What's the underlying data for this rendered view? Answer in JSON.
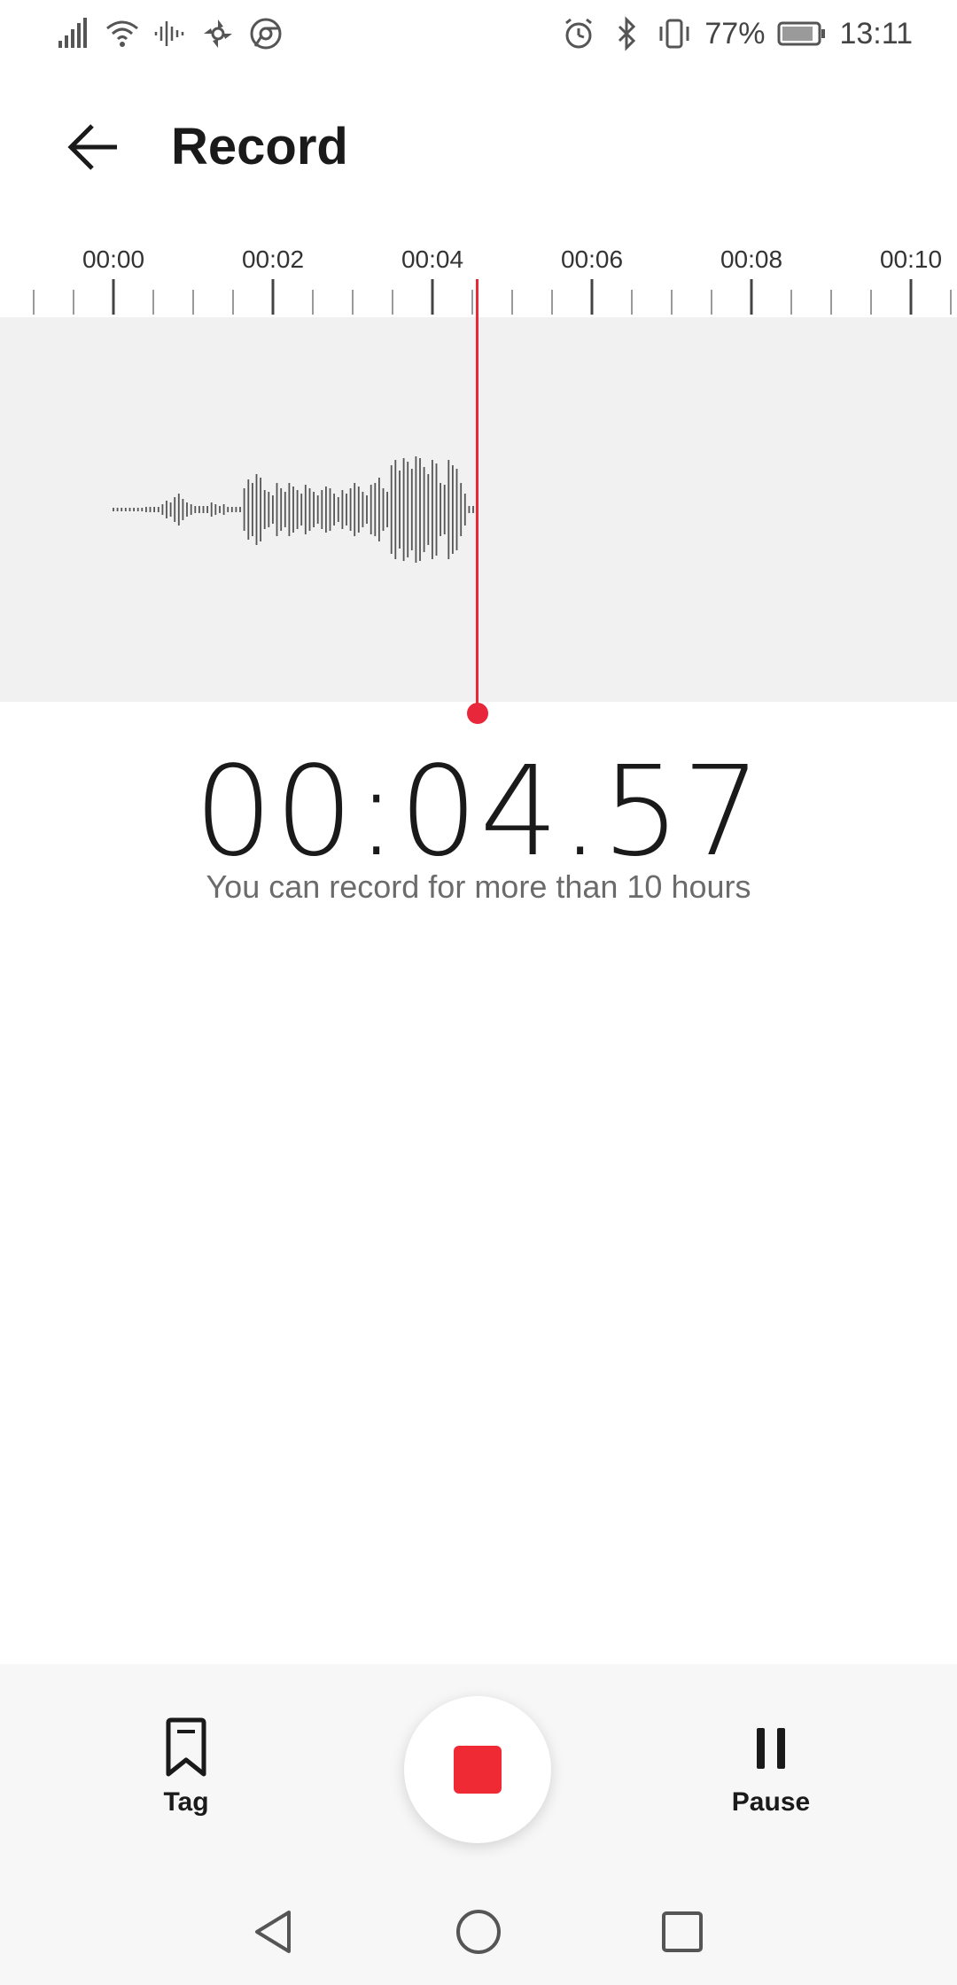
{
  "status_bar": {
    "battery_percent": "77%",
    "time": "13:11",
    "icons_left": [
      "signal-icon",
      "wifi-icon",
      "audio-wave-icon",
      "fan-icon",
      "chrome-icon"
    ],
    "icons_right": [
      "alarm-icon",
      "bluetooth-icon",
      "vibrate-icon",
      "battery-icon"
    ]
  },
  "app_bar": {
    "title": "Record",
    "back_icon": "arrow-left-icon"
  },
  "timeline": {
    "labels": [
      "00:00",
      "00:02",
      "00:04",
      "00:06",
      "00:08",
      "00:10"
    ],
    "playhead_seconds": 4.57
  },
  "recorder": {
    "elapsed": "00:04.57",
    "hint": "You can record for more than 10 hours"
  },
  "controls": {
    "tag_label": "Tag",
    "pause_label": "Pause",
    "stop_icon": "stop-icon"
  },
  "nav": {
    "back_icon": "nav-back-icon",
    "home_icon": "nav-home-icon",
    "recents_icon": "nav-recents-icon"
  },
  "colors": {
    "accent": "#e8273a",
    "stop": "#f02a35",
    "wave_bg": "#f1f1f1"
  }
}
